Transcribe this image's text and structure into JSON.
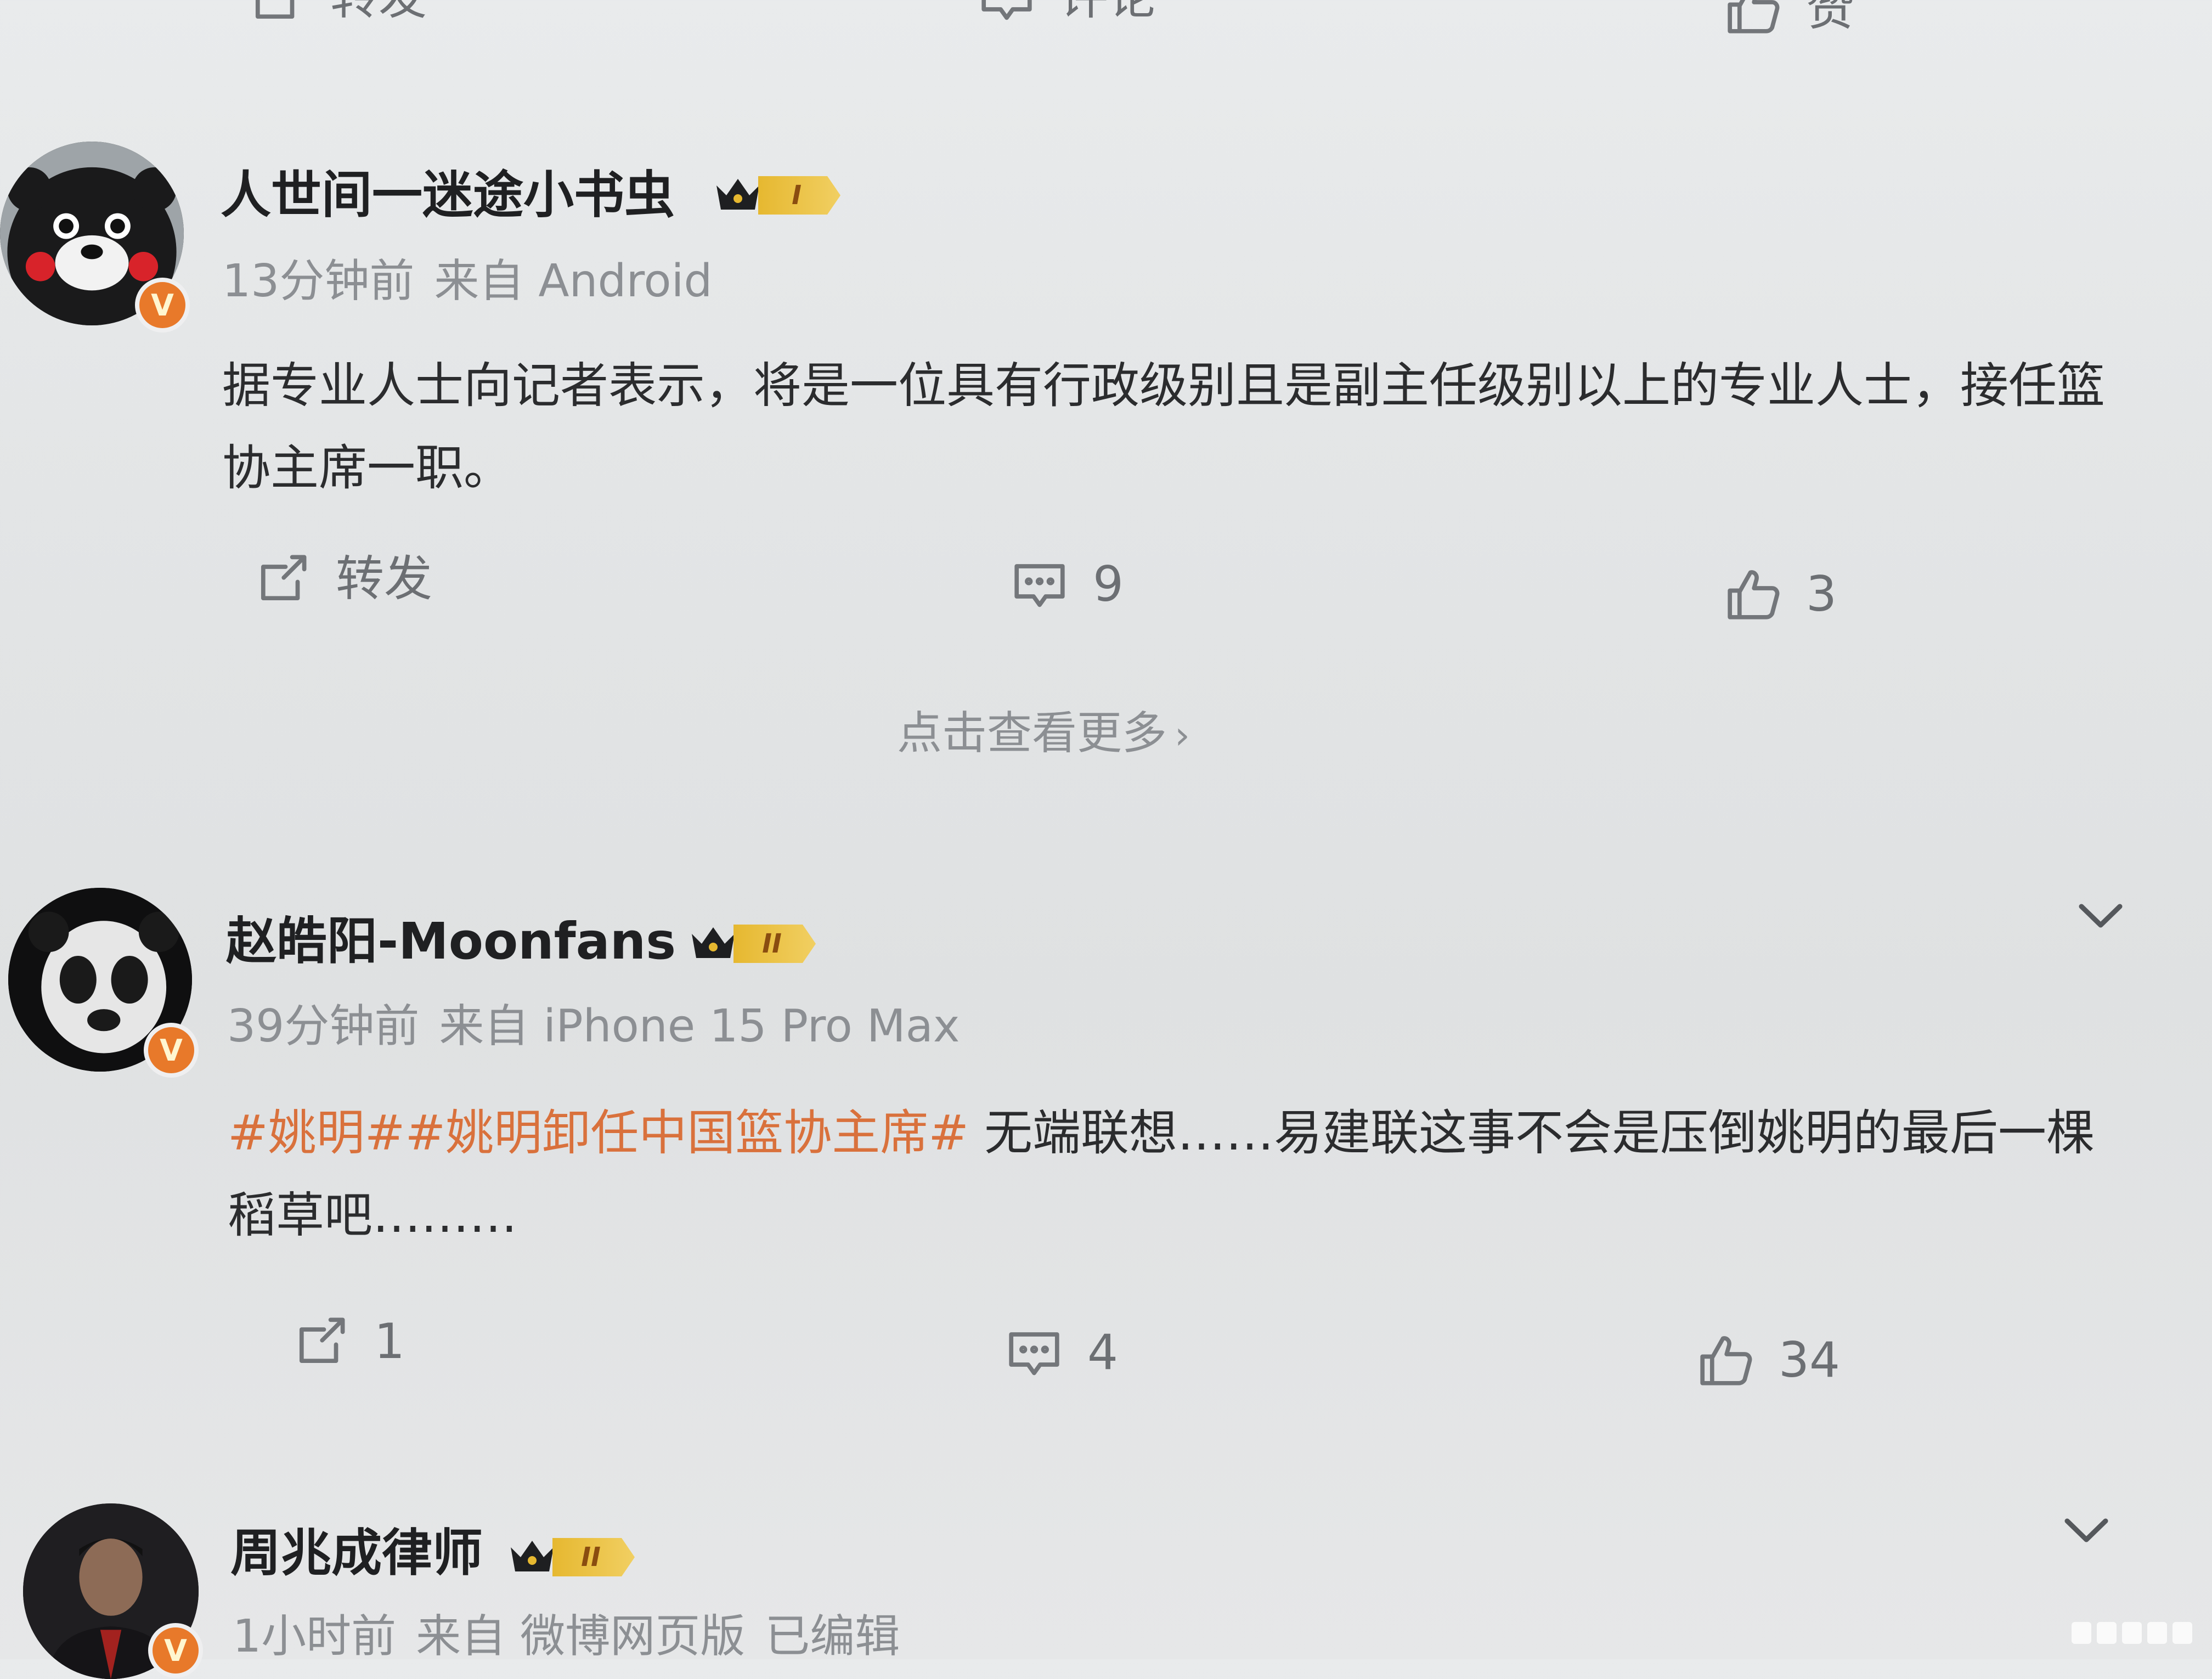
{
  "top_actions": {
    "repost": "转发",
    "comment": "评论",
    "like": "赞"
  },
  "comments": [
    {
      "username": "人世间一迷途小书虫",
      "level": "I",
      "time": "13分钟前",
      "source": "来自 Android",
      "body_text": "据专业人士向记者表示，将是一位具有行政级别且是副主任级别以上的专业人士，接任篮协主席一职。",
      "repost": "转发",
      "comments": "9",
      "likes": "3"
    },
    {
      "username": "赵皓阳-Moonfans",
      "level": "II",
      "time": "39分钟前",
      "source": "来自 iPhone 15 Pro Max",
      "hashtags": "#姚明##姚明卸任中国篮协主席#",
      "body_text": "无端联想……易建联这事不会是压倒姚明的最后一棵稻草吧………",
      "repost": "1",
      "comments": "4",
      "likes": "34"
    },
    {
      "username": "周兆成律师",
      "level": "II",
      "time": "1小时前",
      "source": "来自 微博网页版",
      "edited": "已编辑"
    }
  ],
  "more_link": "点击查看更多",
  "badge": "V",
  "colors": {
    "hashtag": "#d9713c",
    "badge": "#e8792a",
    "crown": "#e6b830"
  }
}
